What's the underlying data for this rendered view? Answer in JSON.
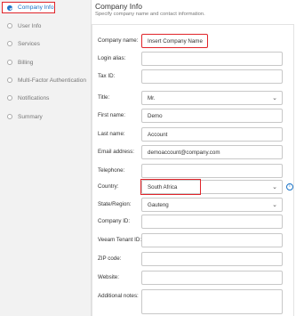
{
  "sidebar": {
    "items": [
      {
        "label": "Company Info"
      },
      {
        "label": "User Info"
      },
      {
        "label": "Services"
      },
      {
        "label": "Billing"
      },
      {
        "label": "Multi-Factor Authentication"
      },
      {
        "label": "Notifications"
      },
      {
        "label": "Summary"
      }
    ]
  },
  "header": {
    "title": "Company Info",
    "subtitle": "Specify company name and contact information."
  },
  "form": {
    "company_name": {
      "label": "Company name:",
      "value": "Insert Company Name"
    },
    "login_alias": {
      "label": "Login alias:",
      "value": ""
    },
    "tax_id": {
      "label": "Tax ID:",
      "value": ""
    },
    "title": {
      "label": "Title:",
      "value": "Mr."
    },
    "first_name": {
      "label": "First name:",
      "value": "Demo"
    },
    "last_name": {
      "label": "Last name:",
      "value": "Account"
    },
    "email": {
      "label": "Email address:",
      "value": "demoaccount@company.com"
    },
    "telephone": {
      "label": "Telephone:",
      "value": ""
    },
    "country": {
      "label": "Country:",
      "value": "South Africa"
    },
    "state": {
      "label": "State/Region:",
      "value": "Gauteng"
    },
    "company_id": {
      "label": "Company ID:",
      "value": ""
    },
    "tenant_id": {
      "label": "Veeam Tenant ID:",
      "value": ""
    },
    "zip": {
      "label": "ZIP code:",
      "value": ""
    },
    "website": {
      "label": "Website:",
      "value": ""
    },
    "notes": {
      "label": "Additional notes:",
      "value": ""
    }
  },
  "icons": {
    "info": "info-icon",
    "chevron": "chevron-down-icon",
    "step_done": "check-circle-icon",
    "step_pending": "circle-icon"
  },
  "colors": {
    "accent": "#1a73c7",
    "highlight": "#e0242a"
  }
}
